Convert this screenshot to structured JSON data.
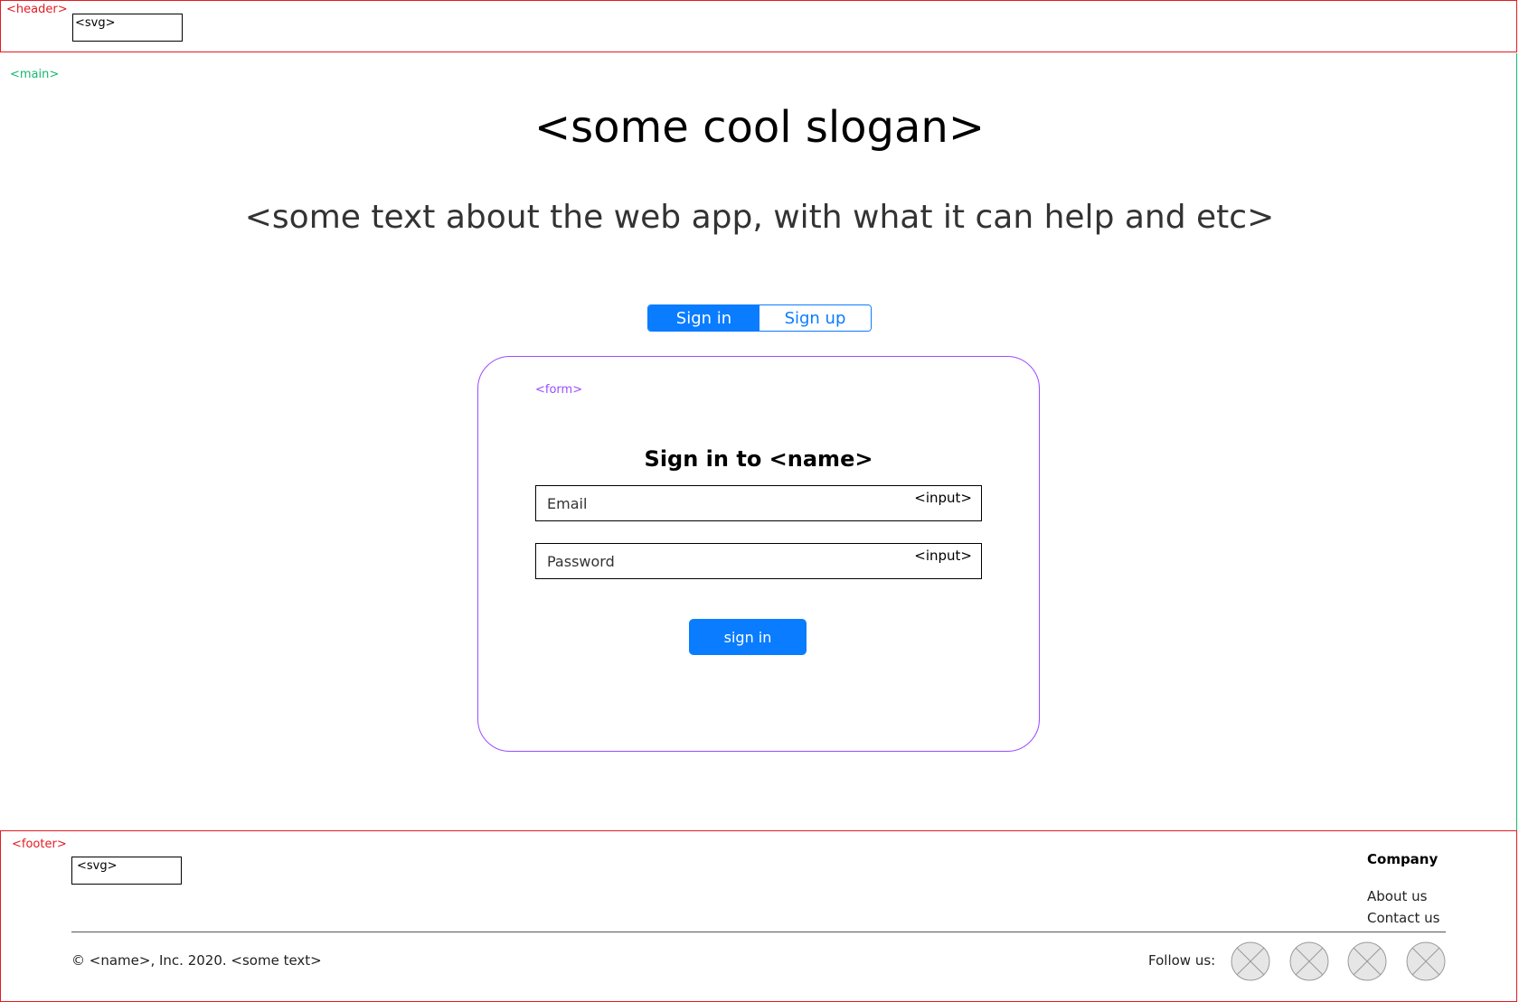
{
  "header": {
    "tag": "<header>",
    "logo_label": "<svg>"
  },
  "main": {
    "tag": "<main>",
    "slogan": "<some cool slogan>",
    "description": "<some text about the web app, with what it can help and etc>",
    "tabs": [
      {
        "label": "Sign in",
        "active": true
      },
      {
        "label": "Sign up",
        "active": false
      }
    ]
  },
  "form": {
    "tag": "<form>",
    "title": "Sign in to <name>",
    "email": {
      "placeholder": "Email",
      "tag": "<input>"
    },
    "password": {
      "placeholder": "Password",
      "tag": "<input>"
    },
    "submit_label": "sign in"
  },
  "footer": {
    "tag": "<footer>",
    "logo_label": "<svg>",
    "company_heading": "Company",
    "links": [
      "About us",
      "Contact us"
    ],
    "copyright": "© <name>, Inc. 2020. <some text>",
    "follow_label": "Follow us:",
    "social_icons": [
      "placeholder-icon",
      "placeholder-icon",
      "placeholder-icon",
      "placeholder-icon"
    ]
  },
  "colors": {
    "accent": "#0a7cff",
    "header_border": "#e31b23",
    "main_border": "#14b86a",
    "form_border": "#9b4dff"
  }
}
